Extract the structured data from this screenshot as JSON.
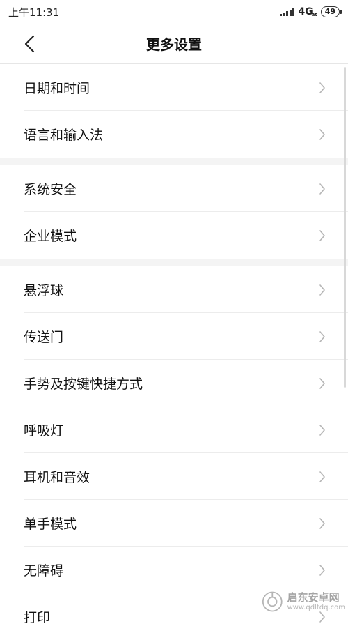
{
  "status_bar": {
    "time": "上午11:31",
    "network": "4G",
    "network_sub": "at",
    "battery": "49"
  },
  "header": {
    "title": "更多设置",
    "back_icon": "chevron-left-icon"
  },
  "groups": [
    {
      "items": [
        {
          "label": "日期和时间"
        },
        {
          "label": "语言和输入法"
        }
      ]
    },
    {
      "items": [
        {
          "label": "系统安全"
        },
        {
          "label": "企业模式"
        }
      ]
    },
    {
      "items": [
        {
          "label": "悬浮球"
        },
        {
          "label": "传送门"
        },
        {
          "label": "手势及按键快捷方式"
        },
        {
          "label": "呼吸灯"
        },
        {
          "label": "耳机和音效"
        },
        {
          "label": "单手模式"
        },
        {
          "label": "无障碍"
        },
        {
          "label": "打印"
        }
      ]
    }
  ],
  "watermark": {
    "name": "启东安卓网",
    "url": "www.qdltdq.com"
  },
  "colors": {
    "text": "#111111",
    "chevron": "#b5b5b5",
    "divider": "#ececec",
    "section_gap": "#f4f4f4"
  }
}
